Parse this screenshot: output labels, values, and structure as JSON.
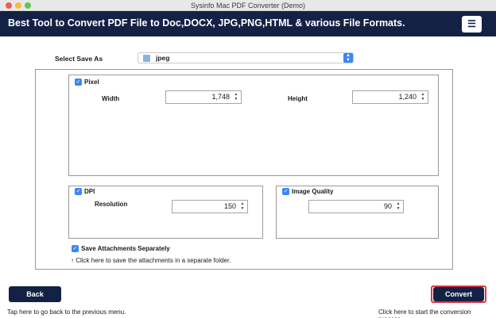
{
  "window": {
    "title": "Sysinfo Mac PDF Converter (Demo)"
  },
  "banner": {
    "headline": "Best Tool to Convert PDF File to Doc,DOCX, JPG,PNG,HTML & various File Formats.",
    "menu_icon": "hamburger-icon"
  },
  "save_as": {
    "label": "Select Save As",
    "value": "jpeg",
    "icon": "image-file-icon"
  },
  "pixel": {
    "label": "Pixel",
    "checked": true,
    "width_label": "Width",
    "width_value": "1,748",
    "height_label": "Height",
    "height_value": "1,240"
  },
  "dpi": {
    "label": "DPI",
    "checked": true,
    "resolution_label": "Resolution",
    "resolution_value": "150"
  },
  "image_quality": {
    "label": "Image Quality",
    "checked": true,
    "value": "90"
  },
  "attachments": {
    "label": "Save Attachments Separately",
    "checked": true,
    "hint": "↑ Click here to save the attachments in a separate folder."
  },
  "footer": {
    "back_label": "Back",
    "back_hint": "Tap here to go back to the previous menu.",
    "convert_label": "Convert",
    "convert_hint": "Click here to start the conversion process."
  },
  "colors": {
    "banner": "#132244",
    "accent": "#3b86f7",
    "convert_border": "#d8374a"
  }
}
